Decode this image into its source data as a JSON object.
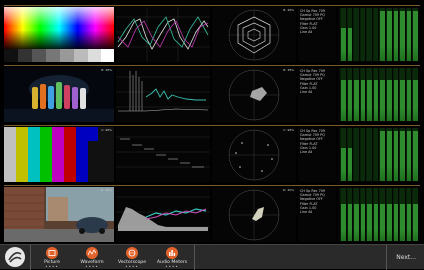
{
  "rows": [
    {
      "image_label": "",
      "waveform_label": "",
      "vector_label": "B: 46%",
      "info": [
        "CH Sp Rec 709",
        "Gamut 709 PQ",
        "Negative OFF",
        "Filter FLAT",
        "Gain 1.00",
        "Line All"
      ],
      "meters": [
        0.62,
        0.62,
        0.0,
        0.0,
        0.0,
        0.0,
        0.95,
        0.95,
        0.95,
        0.95,
        0.95,
        0.95
      ]
    },
    {
      "image_label": "B: 38%",
      "waveform_label": "",
      "vector_label": "B: 38%",
      "info": [
        "CH Sp Rec 709",
        "Gamut 709 PQ",
        "Negative OFF",
        "Filter FLAT",
        "Gain 1.00",
        "Line All"
      ],
      "meters": [
        0.78,
        0.78,
        0.78,
        0.78,
        0.78,
        0.78,
        0.78,
        0.78,
        0.78,
        0.78,
        0.78,
        0.78
      ]
    },
    {
      "image_label": "C: 98%",
      "waveform_label": "",
      "vector_label": "C: 98%",
      "info": [
        "CH Sp Rec 709",
        "Gamut 709 PQ",
        "Negative OFF",
        "Filter FLAT",
        "Gain 1.00",
        "Line All"
      ],
      "meters": [
        0.62,
        0.62,
        0.0,
        0.0,
        0.0,
        0.0,
        0.95,
        0.95,
        0.95,
        0.95,
        0.95,
        0.95
      ]
    },
    {
      "image_label": "D: 40%",
      "waveform_label": "",
      "vector_label": "D: 40%",
      "info": [
        "CH Sp Rec 709",
        "Gamut 709 PQ",
        "Negative OFF",
        "Filter FLAT",
        "Gain 1.00",
        "Line All"
      ],
      "meters": [
        0.7,
        0.7,
        0.7,
        0.7,
        0.7,
        0.7,
        0.7,
        0.7,
        0.7,
        0.7,
        0.7,
        0.7
      ]
    }
  ],
  "toolbar": {
    "buttons": [
      {
        "label": "Picture",
        "icon": "picture-icon",
        "dots": "••••"
      },
      {
        "label": "Waveform",
        "icon": "waveform-icon",
        "dots": "••••"
      },
      {
        "label": "Vectorscope",
        "icon": "vectorscope-icon",
        "dots": "••••"
      },
      {
        "label": "Audio Meters",
        "icon": "audio-meters-icon",
        "dots": "••••"
      }
    ],
    "next_label": "Next..."
  },
  "colors": {
    "accent": "#e2632a",
    "divider": "#7a5c2c",
    "meter_green": "#2e8b2e"
  }
}
